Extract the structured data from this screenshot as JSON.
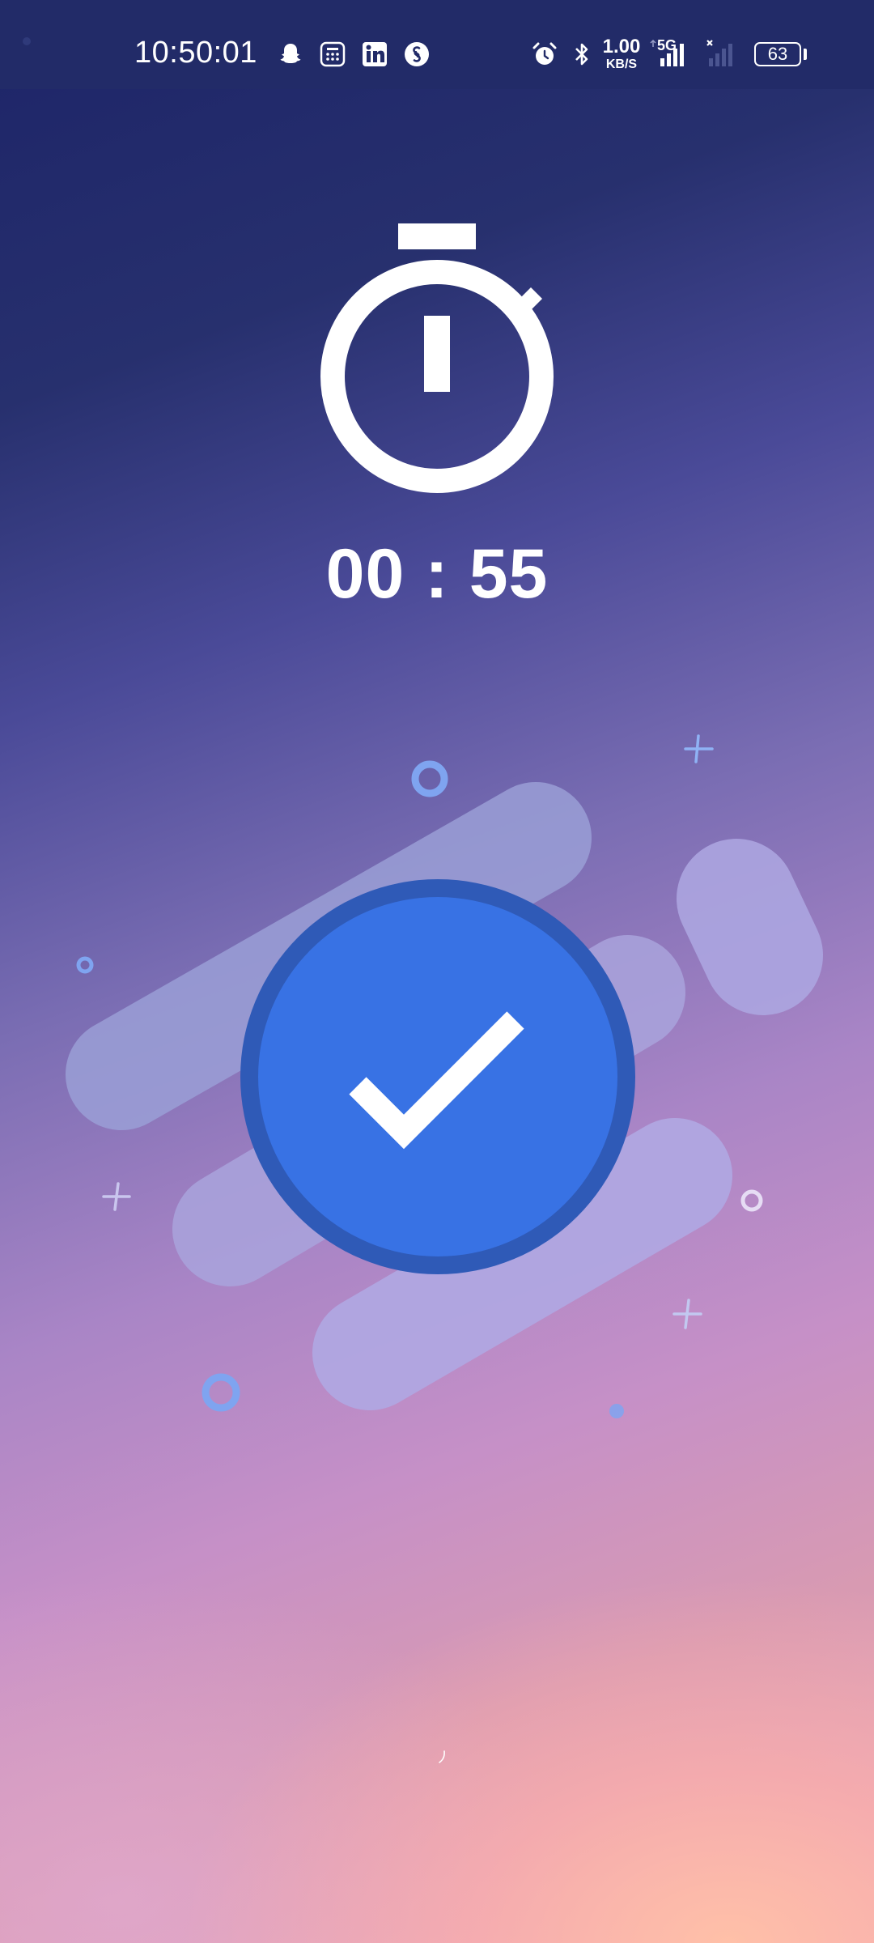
{
  "status_bar": {
    "time": "10:50:01",
    "network_speed_value": "1.00",
    "network_speed_unit": "KB/S",
    "network_type": "5G",
    "battery_level": "63",
    "notification_icons": [
      "snapchat-icon",
      "calculator-icon",
      "linkedin-icon",
      "shazam-icon"
    ],
    "system_icons": [
      "alarm-icon",
      "bluetooth-icon",
      "signal-icon",
      "signal-2-icon"
    ]
  },
  "timer": {
    "readout": "00 : 55",
    "icon": "stopwatch-icon"
  },
  "success": {
    "icon": "checkmark-icon",
    "badge_color": "#3872e4",
    "ring_color": "#2f5ab7"
  },
  "colors": {
    "background_top": "#1d2468",
    "background_bottom": "#ffc0a8",
    "status_bar": "#222b68",
    "pill_light": "#b3a8e4",
    "accent_circle": "#7fa4f0"
  }
}
